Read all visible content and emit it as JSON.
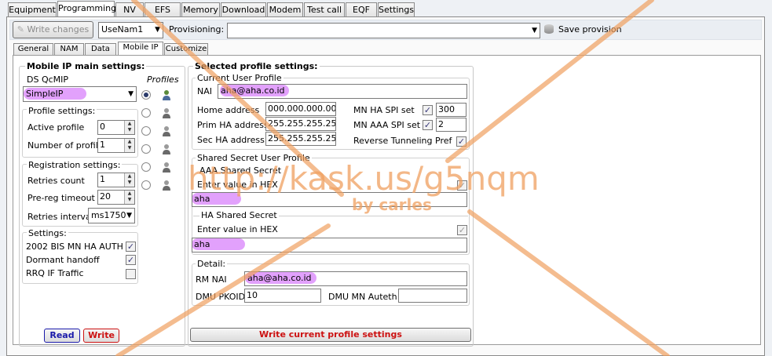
{
  "tabs": [
    "Equipment",
    "Programming",
    "NV",
    "EFS",
    "Memory",
    "Download",
    "Modem",
    "Test call",
    "EQF",
    "Settings"
  ],
  "toolbar": {
    "write_changes": "Write changes",
    "profile_select": "UseNam1",
    "provisioning_label": "Provisioning:",
    "provisioning_value": "",
    "save_provision": "Save provision"
  },
  "subtabs": [
    "General",
    "NAM",
    "Data",
    "Mobile IP",
    "Customize"
  ],
  "left": {
    "title": "Mobile IP main settings:",
    "ds_qcmip_label": "DS QcMIP",
    "ds_qcmip_value": "SimpleIP",
    "profiles_label": "Profiles",
    "profile_settings_label": "Profile settings:",
    "active_profile_label": "Active profile",
    "active_profile_value": "0",
    "num_profiles_label": "Number of profiles",
    "num_profiles_value": "1",
    "registration_label": "Registration settings:",
    "retries_count_label": "Retries count",
    "retries_count_value": "1",
    "prereg_label": "Pre-reg timeout",
    "prereg_value": "20",
    "retries_interval_label": "Retries interval",
    "retries_interval_value": "ms1750",
    "settings_label": "Settings:",
    "bis_label": "2002 BIS MN HA AUTH",
    "dormant_label": "Dormant handoff",
    "rrq_label": "RRQ IF Traffic",
    "read_button": "Read",
    "write_button": "Write"
  },
  "right": {
    "title": "Selected profile settings:",
    "current_profile_label": "Current User Profile",
    "nai_label": "NAI",
    "nai_value": "aha@aha.co.id",
    "home_address_label": "Home address",
    "home_address_value": "000.000.000.000",
    "prim_ha_label": "Prim HA address",
    "prim_ha_value": "255.255.255.255",
    "sec_ha_label": "Sec HA address",
    "sec_ha_value": "255.255.255.255",
    "mn_ha_spi_label": "MN HA SPI set",
    "mn_ha_spi_value": "300",
    "mn_aaa_spi_label": "MN AAA SPI set",
    "mn_aaa_spi_value": "2",
    "reverse_tunnel_label": "Reverse Tunneling Pref",
    "shared_secret_label": "Shared Secret User Profile",
    "aaa_shared_label": "AAA Shared Secret",
    "enter_hex_label": "Enter value in HEX",
    "aaa_value": "aha",
    "ha_shared_label": "HA Shared Secret",
    "enter_hex_label2": "Enter value in HEX",
    "ha_value": "aha",
    "detail_label": "Detail:",
    "rm_nai_label": "RM NAI",
    "rm_nai_value": "aha@aha.co.id",
    "dmu_pkoid_label": "DMU PKOID",
    "dmu_pkoid_value": "10",
    "dmu_mn_auteth_label": "DMU MN Auteth",
    "dmu_mn_auteth_value": "",
    "write_profile_button": "Write current profile settings"
  },
  "watermark": {
    "url": "http://kask.us/g5nqm",
    "author": "by carles"
  },
  "colors": {
    "watermark": "#f0a060",
    "highlight": "#d26efa",
    "read": "#1a1aaa",
    "write": "#cc1111"
  }
}
